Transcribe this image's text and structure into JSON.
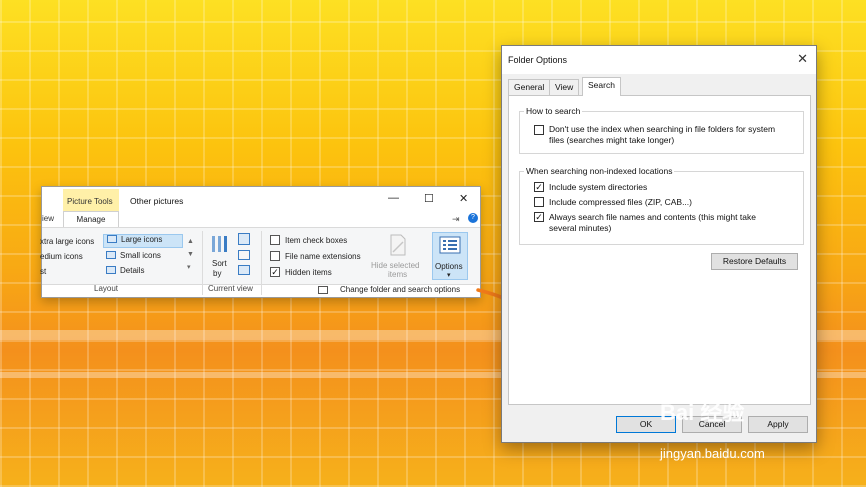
{
  "explorer": {
    "context_tab": "Picture Tools",
    "title": "Other pictures",
    "window_controls": {
      "minimize": "—",
      "maximize": "☐",
      "close": "✕"
    },
    "tabs": {
      "partial_view": "iew",
      "manage": "Manage"
    },
    "layout_items": [
      "xtra large icons",
      "Large icons",
      "edium icons",
      "Small icons",
      "st",
      "Details"
    ],
    "layout_selected": "Large icons",
    "layout_footer": "Layout",
    "sort_label": "Sort",
    "sort_by": "by",
    "current_view_footer": "Current view",
    "checkboxes": [
      {
        "label": "Item check boxes",
        "checked": false
      },
      {
        "label": "File name extensions",
        "checked": false
      },
      {
        "label": "Hidden items",
        "checked": true
      }
    ],
    "hide_selected": [
      "Hide selected",
      "items"
    ],
    "options_label": "Options",
    "change_options": "Change folder and search options",
    "check_mark": "✓",
    "dropdown_glyph": "▾"
  },
  "dialog": {
    "title": "Folder Options",
    "close_glyph": "✕",
    "tabs": [
      "General",
      "View",
      "Search"
    ],
    "active_tab": "Search",
    "how_to_search": {
      "legend": "How to search",
      "option_line1": "Don't use the index when searching in file folders for system",
      "option_line2": "files (searches might take longer)",
      "checked": false
    },
    "non_indexed": {
      "legend": "When searching non-indexed locations",
      "include_system": "Include system directories",
      "include_compressed": "Include compressed files (ZIP, CAB...)",
      "always_line1": "Always search file names and contents (this might take",
      "always_line2": "several minutes)",
      "checked": [
        true,
        false,
        true
      ]
    },
    "restore_defaults": "Restore Defaults",
    "buttons": {
      "ok": "OK",
      "cancel": "Cancel",
      "apply": "Apply"
    }
  },
  "watermark": {
    "brand": "Bai 经验",
    "url": "jingyan.baidu.com"
  },
  "colors": {
    "arrow": "#f07a1a",
    "accent": "#0078d7",
    "selected": "#cce4f7"
  }
}
